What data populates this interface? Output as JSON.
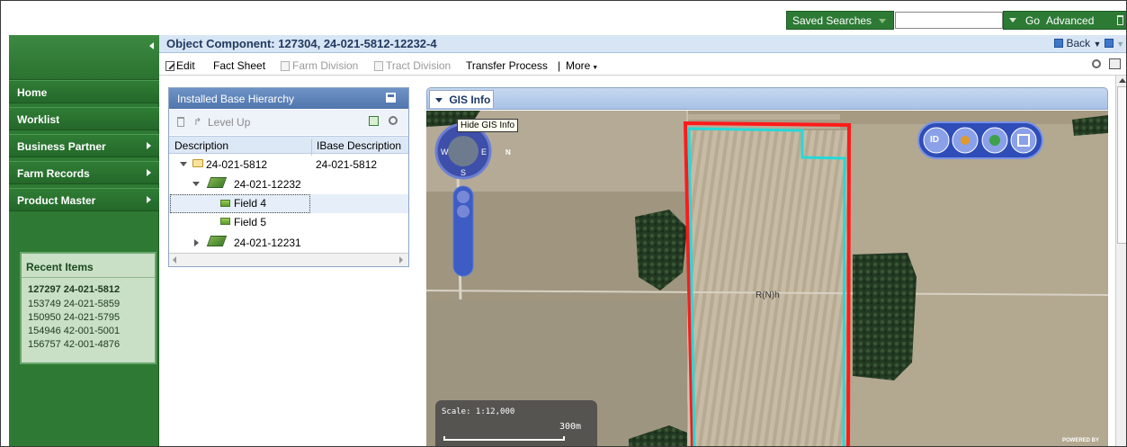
{
  "topbar": {
    "saved_searches_label": "Saved Searches",
    "search_value": "",
    "go_label": "Go",
    "advanced_label": "Advanced"
  },
  "nav": {
    "items": [
      {
        "label": "Home",
        "has_submenu": false
      },
      {
        "label": "Worklist",
        "has_submenu": false
      },
      {
        "label": "Business Partner",
        "has_submenu": true
      },
      {
        "label": "Farm Records",
        "has_submenu": true
      },
      {
        "label": "Product Master",
        "has_submenu": true
      }
    ],
    "recent_title": "Recent Items",
    "recent_items": [
      "127297 24-021-5812",
      "153749 24-021-5859",
      "150950 24-021-5795",
      "154946 42-001-5001",
      "156757 42-001-4876"
    ]
  },
  "header": {
    "title": "Object Component: 127304, 24-021-5812-12232-4",
    "back_label": "Back"
  },
  "toolbar": {
    "edit_label": "Edit",
    "fact_sheet_label": "Fact Sheet",
    "farm_division_label": "Farm Division",
    "tract_division_label": "Tract Division",
    "transfer_process_label": "Transfer Process",
    "separator": "|",
    "more_label": "More"
  },
  "hierarchy": {
    "title": "Installed Base Hierarchy",
    "level_up_label": "Level Up",
    "columns": [
      "Description",
      "IBase Description"
    ],
    "rows": [
      {
        "description": "24-021-5812",
        "ibase": "24-021-5812"
      },
      {
        "description": "24-021-12232",
        "ibase": ""
      },
      {
        "description": "Field 4",
        "ibase": ""
      },
      {
        "description": "Field 5",
        "ibase": ""
      },
      {
        "description": "24-021-12231",
        "ibase": ""
      }
    ]
  },
  "gis": {
    "title": "GIS Info",
    "tooltip": "Hide GIS Info",
    "compass": {
      "w": "W",
      "e": "E",
      "s": "S",
      "n": "N"
    },
    "tool_id_label": "ID",
    "scale_label": "Scale: 1:12,000",
    "scale_distance": "300m",
    "map_label": "R(N)h",
    "powered_by": "POWERED BY"
  },
  "colors": {
    "nav_green": "#2e7a34",
    "header_blue": "#d8e5f5",
    "boundary_red": "#ff1a1a",
    "boundary_cyan": "#28d8d8"
  }
}
